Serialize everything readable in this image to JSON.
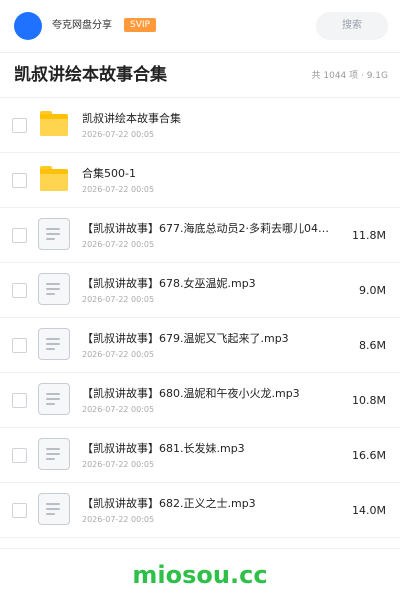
{
  "header": {
    "user_name": "夸克网盘分享",
    "badge": "SVIP",
    "search_placeholder": "搜索"
  },
  "folder": {
    "title": "凯叔讲绘本故事合集",
    "summary": "共 1044 项 · 9.1G"
  },
  "files": [
    {
      "type": "folder",
      "name": "凯叔讲绘本故事合集",
      "date": "2026-07-22 00:05",
      "size": ""
    },
    {
      "type": "folder",
      "name": "合集500-1",
      "date": "2026-07-22 00:05",
      "size": ""
    },
    {
      "type": "file",
      "name": "【凯叔讲故事】677.海底总动员2·多莉去哪儿04…",
      "date": "2026-07-22 00:05",
      "size": "11.8M"
    },
    {
      "type": "file",
      "name": "【凯叔讲故事】678.女巫温妮.mp3",
      "date": "2026-07-22 00:05",
      "size": "9.0M"
    },
    {
      "type": "file",
      "name": "【凯叔讲故事】679.温妮又飞起来了.mp3",
      "date": "2026-07-22 00:05",
      "size": "8.6M"
    },
    {
      "type": "file",
      "name": "【凯叔讲故事】680.温妮和午夜小火龙.mp3",
      "date": "2026-07-22 00:05",
      "size": "10.8M"
    },
    {
      "type": "file",
      "name": "【凯叔讲故事】681.长发妹.mp3",
      "date": "2026-07-22 00:05",
      "size": "16.6M"
    },
    {
      "type": "file",
      "name": "【凯叔讲故事】682.正义之士.mp3",
      "date": "2026-07-22 00:05",
      "size": "14.0M"
    }
  ],
  "watermark": "miosou.cc",
  "colors": {
    "avatar": "#1e72ff",
    "badge": "#ff9a3c",
    "folder": "#ffc107",
    "watermark": "#2fc04a"
  }
}
